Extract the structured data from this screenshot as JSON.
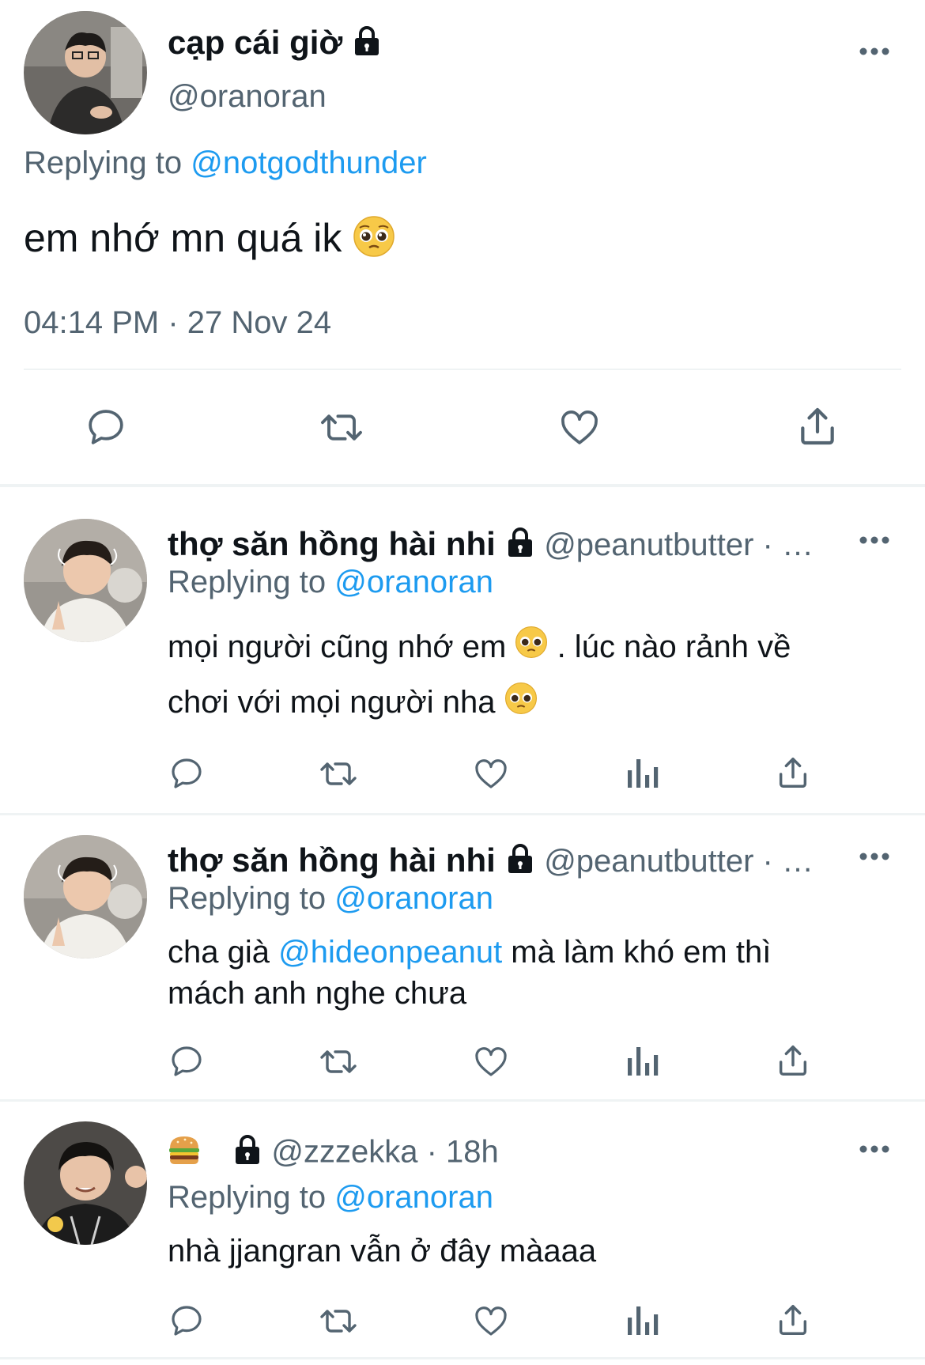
{
  "main_tweet": {
    "display_name": "cạp cái giờ",
    "handle": "@oranoran",
    "replying_prefix": "Replying to",
    "replying_to": "@notgodthunder",
    "text": "em nhớ mn quá ik",
    "emoji": "pleading-face",
    "timestamp": "04:14 PM · 27 Nov 24",
    "actions": [
      "reply",
      "retweet",
      "like",
      "share"
    ]
  },
  "replies": [
    {
      "display_name": "thợ săn hồng hài nhi",
      "handle_meta": "@peanutbutter · …",
      "replying_prefix": "Replying to",
      "replying_to": "@oranoran",
      "text_1": "mọi người cũng nhớ em",
      "text_2": ". lúc nào rảnh về",
      "text_3": "chơi với mọi người nha"
    },
    {
      "display_name": "thợ săn hồng hài nhi",
      "handle_meta": "@peanutbutter · …",
      "replying_prefix": "Replying to",
      "replying_to": "@oranoran",
      "text_pre": "cha già ",
      "mention": "@hideonpeanut",
      "text_post": " mà làm khó em thì",
      "text_line2": "mách anh nghe chưa"
    },
    {
      "display_name_emoji": "hamburger",
      "handle_meta": "@zzzekka · 18h",
      "replying_prefix": "Replying to",
      "replying_to": "@oranoran",
      "text": "nhà jjangran vẫn ở đây màaaa"
    }
  ],
  "reply_actions": [
    "reply",
    "retweet",
    "like",
    "views",
    "share"
  ],
  "colors": {
    "accent": "#1d9bf0",
    "secondary": "#536471",
    "text": "#0f1419",
    "divider": "#eff3f4"
  }
}
